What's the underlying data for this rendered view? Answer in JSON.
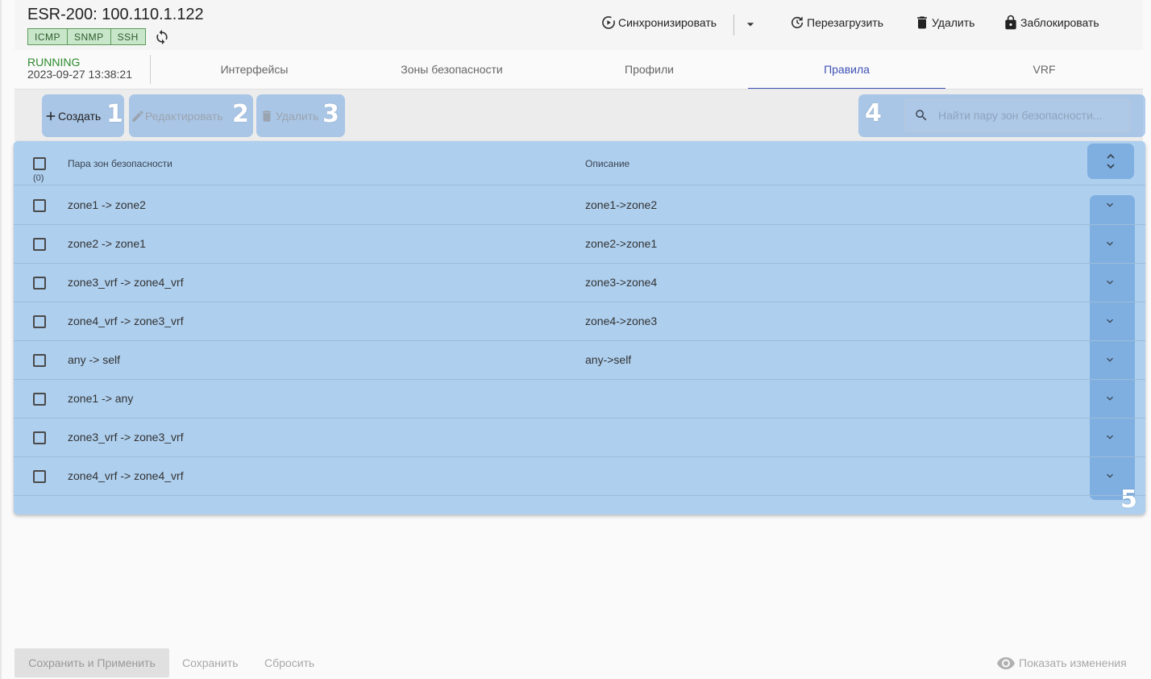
{
  "header": {
    "title": "ESR-200: 100.110.1.122",
    "badges": [
      "ICMP",
      "SNMP",
      "SSH"
    ],
    "actions": {
      "sync": "Синхронизировать",
      "reboot": "Перезагрузить",
      "delete": "Удалить",
      "lock": "Заблокировать"
    }
  },
  "status": {
    "state": "RUNNING",
    "timestamp": "2023-09-27 13:38:21"
  },
  "tabs": [
    "Интерфейсы",
    "Зоны безопасности",
    "Профили",
    "Правила",
    "VRF"
  ],
  "active_tab": "Правила",
  "toolbar": {
    "create": "Создать",
    "edit": "Редактировать",
    "delete": "Удалить",
    "search_placeholder": "Найти пару зон безопасности..."
  },
  "annotations": [
    "1",
    "2",
    "3",
    "4",
    "5"
  ],
  "table": {
    "columns": [
      "Пара зон безопасности",
      "Описание"
    ],
    "selected_count": "(0)",
    "rows": [
      {
        "pair": "zone1 -> zone2",
        "description": "zone1->zone2"
      },
      {
        "pair": "zone2 -> zone1",
        "description": "zone2->zone1"
      },
      {
        "pair": "zone3_vrf -> zone4_vrf",
        "description": "zone3->zone4"
      },
      {
        "pair": "zone4_vrf -> zone3_vrf",
        "description": "zone4->zone3"
      },
      {
        "pair": "any -> self",
        "description": "any->self"
      },
      {
        "pair": "zone1 -> any",
        "description": ""
      },
      {
        "pair": "zone3_vrf -> zone3_vrf",
        "description": ""
      },
      {
        "pair": "zone4_vrf -> zone4_vrf",
        "description": ""
      }
    ]
  },
  "footer": {
    "save_apply": "Сохранить и Применить",
    "save": "Сохранить",
    "reset": "Сбросить",
    "show_changes": "Показать изменения"
  },
  "colors": {
    "accent": "#3f51b5",
    "running": "#2e8b2e",
    "highlight": "#7aaae2",
    "table_bg": "#aecfee"
  }
}
